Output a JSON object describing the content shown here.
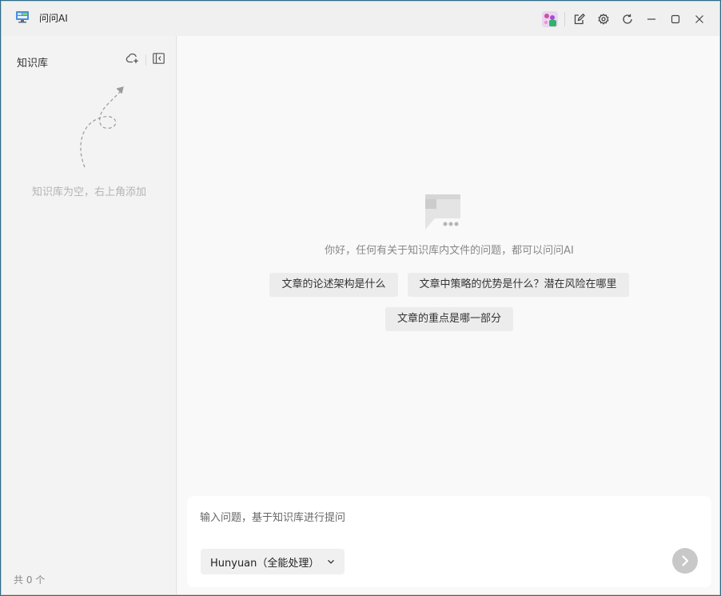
{
  "window": {
    "title": "问问AI"
  },
  "titlebar": {
    "icons": [
      "avatar",
      "notes-icon",
      "gear-icon",
      "refresh-icon",
      "minimize-icon",
      "maximize-icon",
      "close-icon"
    ]
  },
  "sidebar": {
    "title": "知识库",
    "empty_text": "知识库为空，右上角添加",
    "count_text": "共 0 个"
  },
  "main": {
    "greeting": "你好，任何有关于知识库内文件的问题，都可以问问AI",
    "suggestions": [
      "文章的论述架构是什么",
      "文章中策略的优势是什么？潜在风险在哪里",
      "文章的重点是哪一部分"
    ]
  },
  "input": {
    "placeholder": "输入问题，基于知识库进行提问",
    "value": "",
    "model_selected": "Hunyuan（全能处理）"
  },
  "colors": {
    "sidebar_bg": "#f3f3f3",
    "main_bg": "#f9f9f9",
    "chip_bg": "#ececec",
    "send_disabled": "#c8c8c8"
  }
}
